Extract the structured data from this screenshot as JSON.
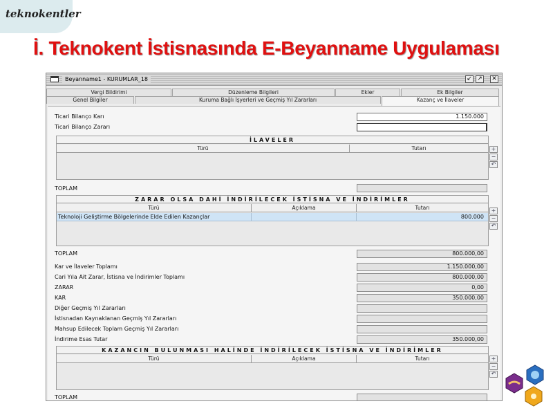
{
  "brand": {
    "text": "teknokentler"
  },
  "slide_title": "İ. Teknokent İstisnasında E-Beyanname Uygulaması",
  "window": {
    "title": "Beyanname1 - KURUMLAR_18",
    "tabs_top": [
      "Vergi Bildirimi",
      "Düzenleme Bilgileri",
      "Ekler",
      "Ek Bilgiler"
    ],
    "tabs_bottom": [
      "Genel Bilgiler",
      "Kuruma Bağlı İşyerleri ve Geçmiş Yıl Zararları",
      "Kazanç ve İlaveler"
    ],
    "active_tab": "Kazanç ve İlaveler"
  },
  "form": {
    "ticari_kar": {
      "label": "Ticari Bilanço Karı",
      "value": "1.150.000"
    },
    "ticari_zarar": {
      "label": "Ticari Bilanço Zararı",
      "value": ""
    },
    "ilaveler": {
      "title": "İLAVELER",
      "columns": [
        "Türü",
        "Tutarı"
      ],
      "toplam_label": "TOPLAM",
      "toplam_value": ""
    },
    "zarar_dahi": {
      "title": "ZARAR OLSA DAHİ İNDİRİLECEK İSTİSNA VE İNDİRİMLER",
      "columns": [
        "Türü",
        "Açıklama",
        "Tutarı"
      ],
      "rows": [
        {
          "turu": "Teknoloji Geliştirme Bölgelerinde Elde Edilen Kazançlar",
          "aciklama": "",
          "tutari": "800.000"
        }
      ],
      "toplam_label": "TOPLAM",
      "toplam_value": "800.000,00"
    },
    "summary": [
      {
        "label": "Kar ve İlaveler Toplamı",
        "value": "1.150.000,00"
      },
      {
        "label": "Cari Yıla Ait Zarar, İstisna ve İndirimler Toplamı",
        "value": "800.000,00"
      },
      {
        "label": "ZARAR",
        "value": "0,00"
      },
      {
        "label": "KAR",
        "value": "350.000,00"
      },
      {
        "label": "Diğer Geçmiş Yıl Zararları",
        "value": ""
      },
      {
        "label": "İstisnadan Kaynaklanan Geçmiş Yıl Zararları",
        "value": ""
      },
      {
        "label": "Mahsup Edilecek Toplam Geçmiş Yıl Zararları",
        "value": ""
      },
      {
        "label": "İndirime Esas Tutar",
        "value": "350.000,00"
      }
    ],
    "kazanc_bulunmasi": {
      "title": "KAZANCIN BULUNMASI HALİNDE İNDİRİLECEK İSTİSNA VE İNDİRİMLER",
      "columns": [
        "Türü",
        "Açıklama",
        "Tutarı"
      ],
      "toplam_label": "TOPLAM",
      "toplam_value": ""
    }
  },
  "side_buttons": {
    "add_icon": "plus-icon",
    "remove_icon": "minus-icon",
    "undo_icon": "undo-icon"
  },
  "colors": {
    "title_red": "#e01010",
    "selected_row": "#cfe4f6",
    "readonly_field": "#e2e2e2"
  },
  "logo": {
    "icon": "teknokent-hexagon-logo"
  }
}
